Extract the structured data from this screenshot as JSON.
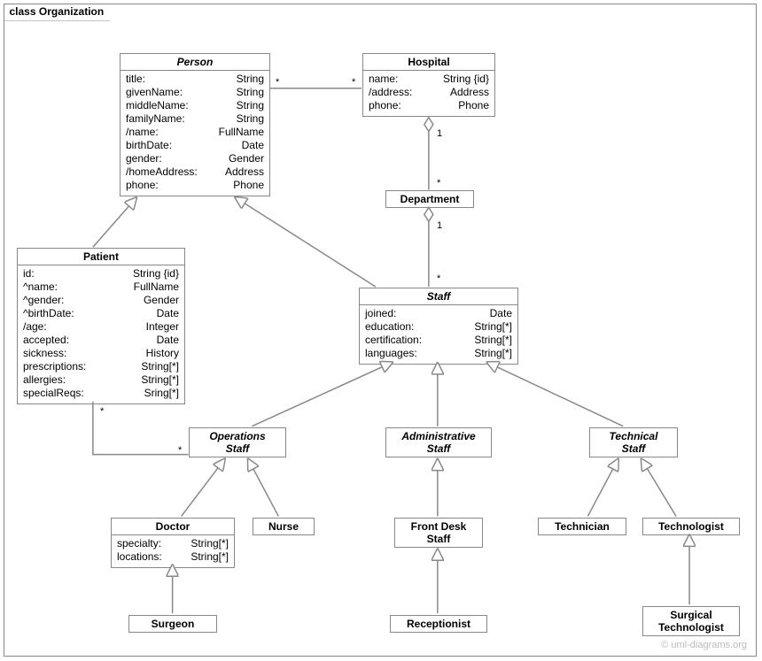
{
  "frame": {
    "label": "class Organization"
  },
  "classes": {
    "person": {
      "name": "Person",
      "attrs": [
        {
          "n": "title:",
          "t": "String"
        },
        {
          "n": "givenName:",
          "t": "String"
        },
        {
          "n": "middleName:",
          "t": "String"
        },
        {
          "n": "familyName:",
          "t": "String"
        },
        {
          "n": "/name:",
          "t": "FullName"
        },
        {
          "n": "birthDate:",
          "t": "Date"
        },
        {
          "n": "gender:",
          "t": "Gender"
        },
        {
          "n": "/homeAddress:",
          "t": "Address"
        },
        {
          "n": "phone:",
          "t": "Phone"
        }
      ]
    },
    "hospital": {
      "name": "Hospital",
      "attrs": [
        {
          "n": "name:",
          "t": "String {id}"
        },
        {
          "n": "/address:",
          "t": "Address"
        },
        {
          "n": "phone:",
          "t": "Phone"
        }
      ]
    },
    "department": {
      "name": "Department"
    },
    "patient": {
      "name": "Patient",
      "attrs": [
        {
          "n": "id:",
          "t": "String {id}"
        },
        {
          "n": "^name:",
          "t": "FullName"
        },
        {
          "n": "^gender:",
          "t": "Gender"
        },
        {
          "n": "^birthDate:",
          "t": "Date"
        },
        {
          "n": "/age:",
          "t": "Integer"
        },
        {
          "n": "accepted:",
          "t": "Date"
        },
        {
          "n": "sickness:",
          "t": "History"
        },
        {
          "n": "prescriptions:",
          "t": "String[*]"
        },
        {
          "n": "allergies:",
          "t": "String[*]"
        },
        {
          "n": "specialReqs:",
          "t": "Sring[*]"
        }
      ]
    },
    "staff": {
      "name": "Staff",
      "attrs": [
        {
          "n": "joined:",
          "t": "Date"
        },
        {
          "n": "education:",
          "t": "String[*]"
        },
        {
          "n": "certification:",
          "t": "String[*]"
        },
        {
          "n": "languages:",
          "t": "String[*]"
        }
      ]
    },
    "opsStaff": {
      "name": "Operations",
      "name2": "Staff"
    },
    "adminStaff": {
      "name": "Administrative",
      "name2": "Staff"
    },
    "techStaff": {
      "name": "Technical",
      "name2": "Staff"
    },
    "doctor": {
      "name": "Doctor",
      "attrs": [
        {
          "n": "specialty:",
          "t": "String[*]"
        },
        {
          "n": "locations:",
          "t": "String[*]"
        }
      ]
    },
    "nurse": {
      "name": "Nurse"
    },
    "frontDesk": {
      "name": "Front Desk",
      "name2": "Staff"
    },
    "receptionist": {
      "name": "Receptionist"
    },
    "technician": {
      "name": "Technician"
    },
    "technologist": {
      "name": "Technologist"
    },
    "surgTech": {
      "name": "Surgical",
      "name2": "Technologist"
    },
    "surgeon": {
      "name": "Surgeon"
    }
  },
  "mult": {
    "personHospL": "*",
    "personHospR": "*",
    "hospDeptTop": "1",
    "hospDeptBot": "*",
    "deptStaffTop": "1",
    "deptStaffBot": "*",
    "patOpsTop": "*",
    "patOpsBot": "*"
  },
  "watermark": "© uml-diagrams.org"
}
